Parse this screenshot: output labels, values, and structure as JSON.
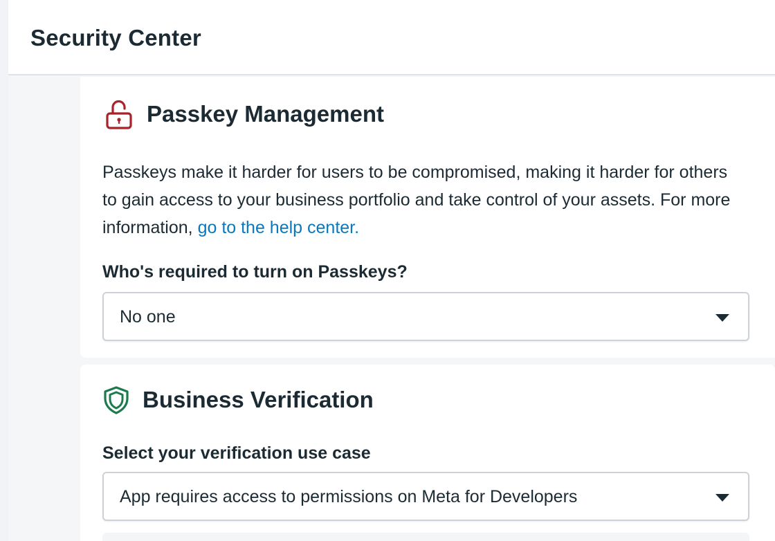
{
  "header": {
    "title": "Security Center"
  },
  "passkey": {
    "icon": "unlocked-padlock-icon",
    "icon_color": "#a8232b",
    "title": "Passkey Management",
    "description": "Passkeys make it harder for users to be compromised, making it harder for others to gain access to your business portfolio and take control of your assets. For more information, ",
    "help_link": "go to the help center.",
    "field_label": "Who's required to turn on Passkeys?",
    "select_value": "No one"
  },
  "verification": {
    "icon": "shield-icon",
    "icon_color": "#1d7a4c",
    "title": "Business Verification",
    "field_label": "Select your verification use case",
    "select_value": "App requires access to permissions on Meta for Developers"
  },
  "colors": {
    "link": "#0a78be",
    "text": "#1c2b33",
    "background": "#f5f6f8"
  }
}
